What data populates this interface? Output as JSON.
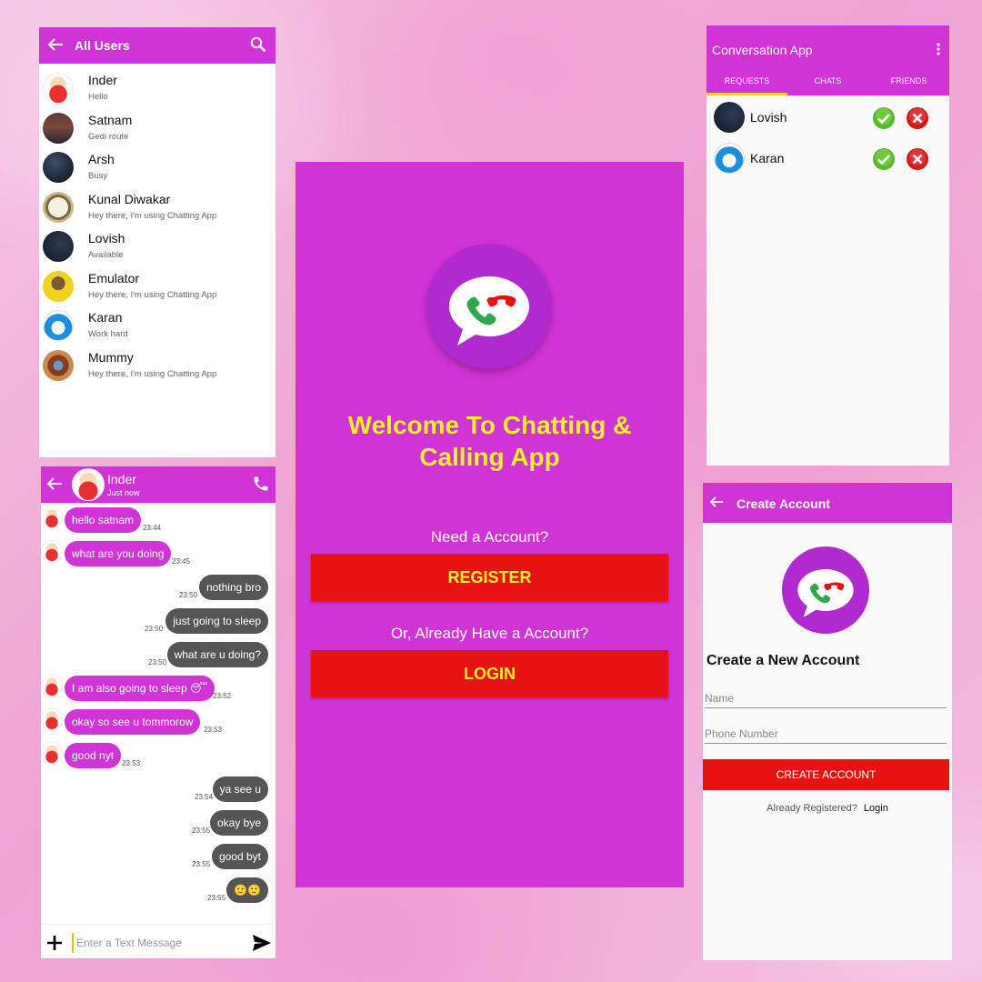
{
  "all_users": {
    "title": "All Users",
    "back_icon": "arrow-left-icon",
    "search_icon": "search-icon",
    "users": [
      {
        "name": "Inder",
        "status": "Hello",
        "avatar": "cartoon-boy-avatar"
      },
      {
        "name": "Satnam",
        "status": "Gedi route",
        "avatar": "sunset-avatar"
      },
      {
        "name": "Arsh",
        "status": "Busy",
        "avatar": "dark-sky-avatar"
      },
      {
        "name": "Kunal Diwakar",
        "status": "Hey there, I'm using Chatting App",
        "avatar": "clock-avatar"
      },
      {
        "name": "Lovish",
        "status": "Available",
        "avatar": "night-avatar"
      },
      {
        "name": "Emulator",
        "status": "Hey there, I'm using Chatting App",
        "avatar": "cricketer-avatar"
      },
      {
        "name": "Karan",
        "status": "Work hard",
        "avatar": "doraemon-avatar"
      },
      {
        "name": "Mummy",
        "status": "Hey there, I'm using Chatting App",
        "avatar": "clock-ornate-avatar"
      }
    ]
  },
  "chat": {
    "contact_name": "Inder",
    "presence": "Just now",
    "call_icon": "phone-icon",
    "messages": [
      {
        "dir": "in",
        "text": "hello satnam",
        "time": "23:44"
      },
      {
        "dir": "in",
        "text": "what are you doing",
        "time": "23:45"
      },
      {
        "dir": "out",
        "text": "nothing bro",
        "time": "23:50"
      },
      {
        "dir": "out",
        "text": "just going to sleep",
        "time": "23:50"
      },
      {
        "dir": "out",
        "text": "what are u doing?",
        "time": "23:50"
      },
      {
        "dir": "in",
        "text": "I am also going to sleep 😴",
        "time": "23:52"
      },
      {
        "dir": "in",
        "text": "okay so see u tommorow",
        "time": "23:53"
      },
      {
        "dir": "in",
        "text": "good nyt",
        "time": "23:53"
      },
      {
        "dir": "out",
        "text": "ya see u",
        "time": "23:54"
      },
      {
        "dir": "out",
        "text": "okay bye",
        "time": "23:55"
      },
      {
        "dir": "out",
        "text": "good byt",
        "time": "23:55"
      },
      {
        "dir": "out",
        "text": "🙂🙂",
        "time": "23:55"
      }
    ],
    "input_placeholder": "Enter a Text Message",
    "attach_icon": "plus-icon",
    "send_icon": "send-icon"
  },
  "welcome": {
    "logo_icon": "chat-call-logo-icon",
    "title": "Welcome To Chatting & Calling App",
    "need_account": "Need a Account?",
    "register_label": "REGISTER",
    "or_have": "Or, Already Have a Account?",
    "login_label": "LOGIN"
  },
  "conversation": {
    "title": "Conversation App",
    "menu_icon": "more-vert-icon",
    "tabs": [
      "REQUESTS",
      "CHATS",
      "FRIENDS"
    ],
    "active_tab": "REQUESTS",
    "requests": [
      {
        "name": "Lovish",
        "avatar": "night-avatar"
      },
      {
        "name": "Karan",
        "avatar": "doraemon-avatar"
      }
    ],
    "accept_icon": "check-circle-icon",
    "decline_icon": "cancel-circle-icon"
  },
  "create_account": {
    "title": "Create Account",
    "heading": "Create a New Account",
    "name_placeholder": "Name",
    "phone_placeholder": "Phone Number",
    "button_label": "CREATE ACCOUNT",
    "already_text": "Already Registered?",
    "login_link": "Login"
  },
  "colors": {
    "primary": "#d033d6",
    "accent_red": "#e81212",
    "title_yellow": "#f0f02c",
    "outgoing_bubble": "#555555"
  }
}
